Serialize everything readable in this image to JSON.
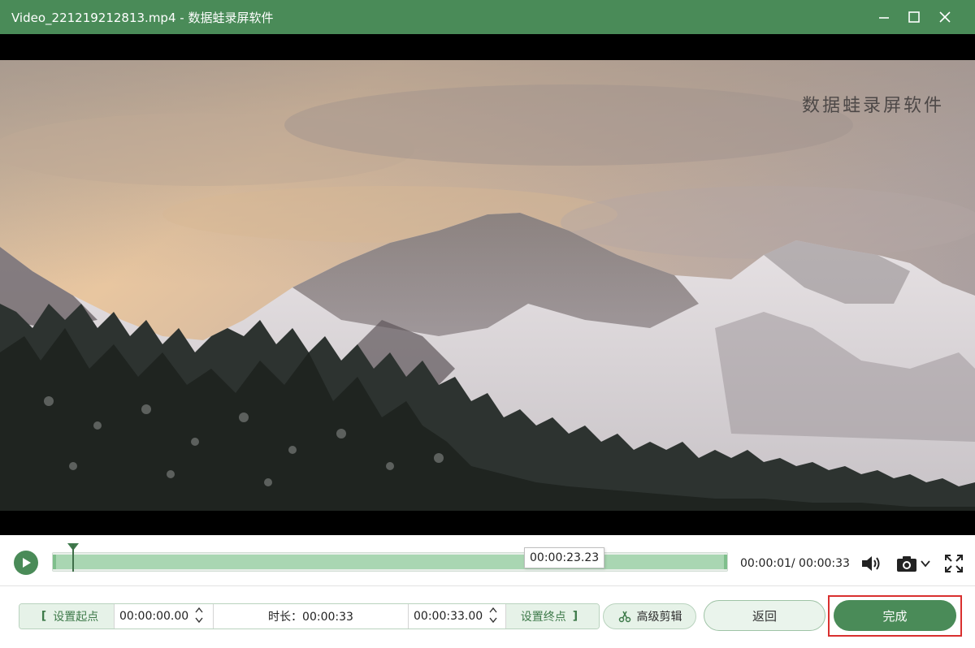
{
  "window": {
    "title": "Video_221219212813.mp4  -  数据蛙录屏软件"
  },
  "video": {
    "watermark": "数据蛙录屏软件"
  },
  "playback": {
    "hover_time": "00:00:23.23",
    "time_readout": "00:00:01/ 00:00:33",
    "progress_fraction": 0.03,
    "hover_fraction": 0.7
  },
  "trim": {
    "set_start_label": "设置起点",
    "start_time": "00:00:00.00",
    "duration_label": "时长：00:00:33",
    "end_time": "00:00:33.00",
    "set_end_label": "设置终点",
    "bracket_open": "[",
    "bracket_close": "]"
  },
  "buttons": {
    "advanced_edit": "高级剪辑",
    "back": "返回",
    "done": "完成"
  },
  "colors": {
    "brand_green": "#4a8b58",
    "range_green": "#a9d6b2",
    "highlight_red": "#d9302f"
  }
}
